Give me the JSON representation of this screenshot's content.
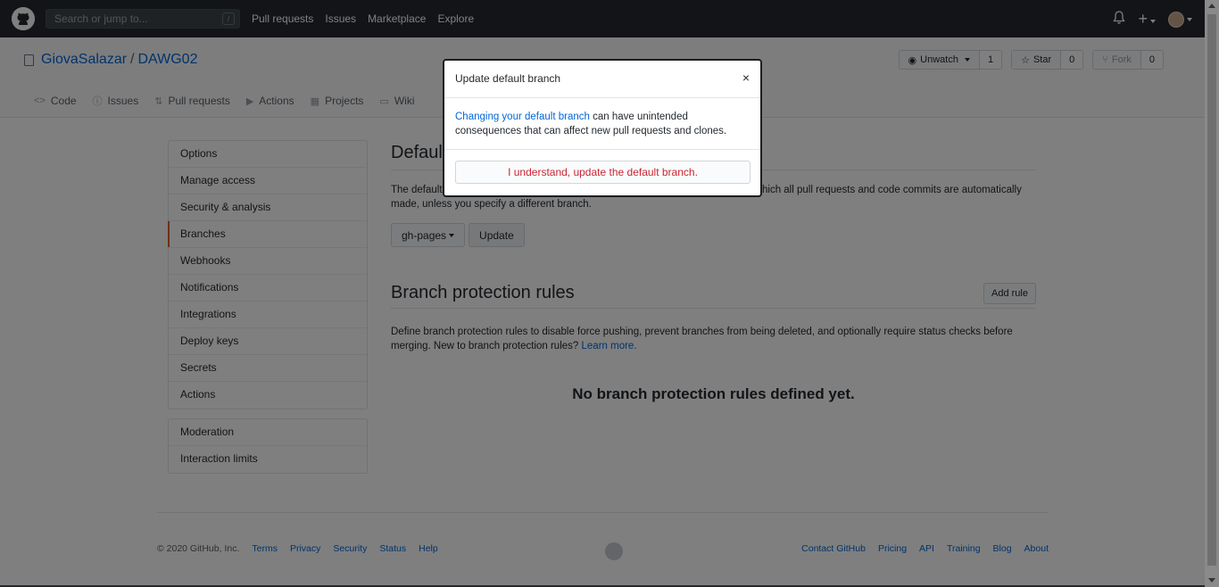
{
  "header": {
    "search_placeholder": "Search or jump to...",
    "search_shortcut": "/",
    "nav": [
      "Pull requests",
      "Issues",
      "Marketplace",
      "Explore"
    ]
  },
  "repo": {
    "owner": "GiovaSalazar",
    "separator": "/",
    "name": "DAWG02",
    "watch_label": "Unwatch",
    "watch_count": "1",
    "star_label": "Star",
    "star_count": "0",
    "fork_label": "Fork",
    "fork_count": "0",
    "tabs": [
      {
        "label": "Code",
        "icon": "code-icon"
      },
      {
        "label": "Issues",
        "icon": "issue-icon"
      },
      {
        "label": "Pull requests",
        "icon": "pull-request-icon"
      },
      {
        "label": "Actions",
        "icon": "play-icon"
      },
      {
        "label": "Projects",
        "icon": "project-icon"
      },
      {
        "label": "Wiki",
        "icon": "book-icon"
      }
    ]
  },
  "sidebar": {
    "items": [
      "Options",
      "Manage access",
      "Security & analysis",
      "Branches",
      "Webhooks",
      "Notifications",
      "Integrations",
      "Deploy keys",
      "Secrets",
      "Actions"
    ],
    "selected": "Branches",
    "moderation_heading": "Moderation",
    "moderation_items": [
      "Interaction limits"
    ]
  },
  "main": {
    "default_title": "Default branch",
    "default_text_start": "The default",
    "default_text_end": "hich all pull requests and code commits are automatically",
    "default_text_line2": "made, unless you specify a different branch.",
    "branch_select": "gh-pages",
    "update_button": "Update",
    "protection_title": "Branch protection rules",
    "add_rule_button": "Add rule",
    "protection_text_line1": "Define branch protection rules to disable force pushing, prevent branches from being deleted, and optionally require status checks before",
    "protection_text_line2": "merging. New to branch protection rules?",
    "learn_more": "Learn more.",
    "empty_state": "No branch protection rules defined yet."
  },
  "footer": {
    "copyright": "© 2020 GitHub, Inc.",
    "left_links": [
      "Terms",
      "Privacy",
      "Security",
      "Status",
      "Help"
    ],
    "right_links": [
      "Contact GitHub",
      "Pricing",
      "API",
      "Training",
      "Blog",
      "About"
    ]
  },
  "dialog": {
    "title": "Update default branch",
    "close": "×",
    "body_link": "Changing your default branch",
    "body_text": " can have unintended consequences that can affect new pull requests and clones.",
    "confirm_button": "I understand, update the default branch."
  },
  "colors": {
    "header_bg": "#24292e",
    "link": "#0366d6",
    "danger": "#cb2431",
    "selected_accent": "#e36209"
  }
}
